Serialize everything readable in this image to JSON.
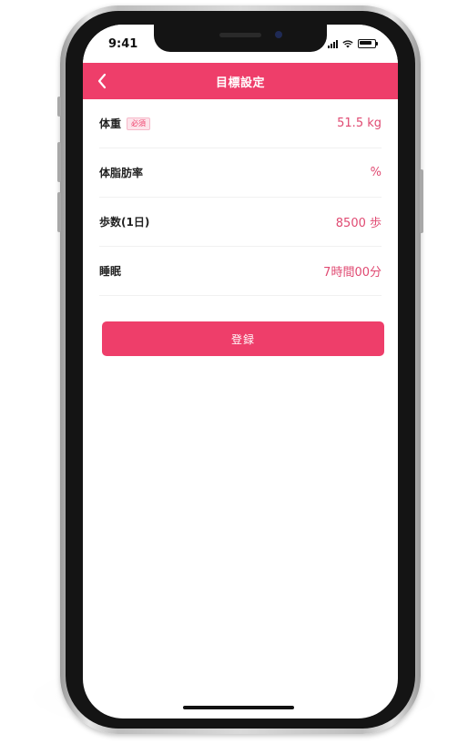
{
  "status_bar": {
    "time": "9:41"
  },
  "header": {
    "title": "目標設定",
    "back_icon": "chevron-left-icon"
  },
  "form": {
    "rows": [
      {
        "label": "体重",
        "badge": "必須",
        "value": "51.5 kg"
      },
      {
        "label": "体脂肪率",
        "badge": "",
        "value": "%"
      },
      {
        "label": "歩数(1日)",
        "badge": "",
        "value": "8500 歩"
      },
      {
        "label": "睡眠",
        "badge": "",
        "value": "7時間00分"
      }
    ]
  },
  "actions": {
    "submit_label": "登録"
  },
  "colors": {
    "accent": "#ee3e6a",
    "value_text": "#e04a72",
    "badge_bg": "#fde3ea"
  }
}
